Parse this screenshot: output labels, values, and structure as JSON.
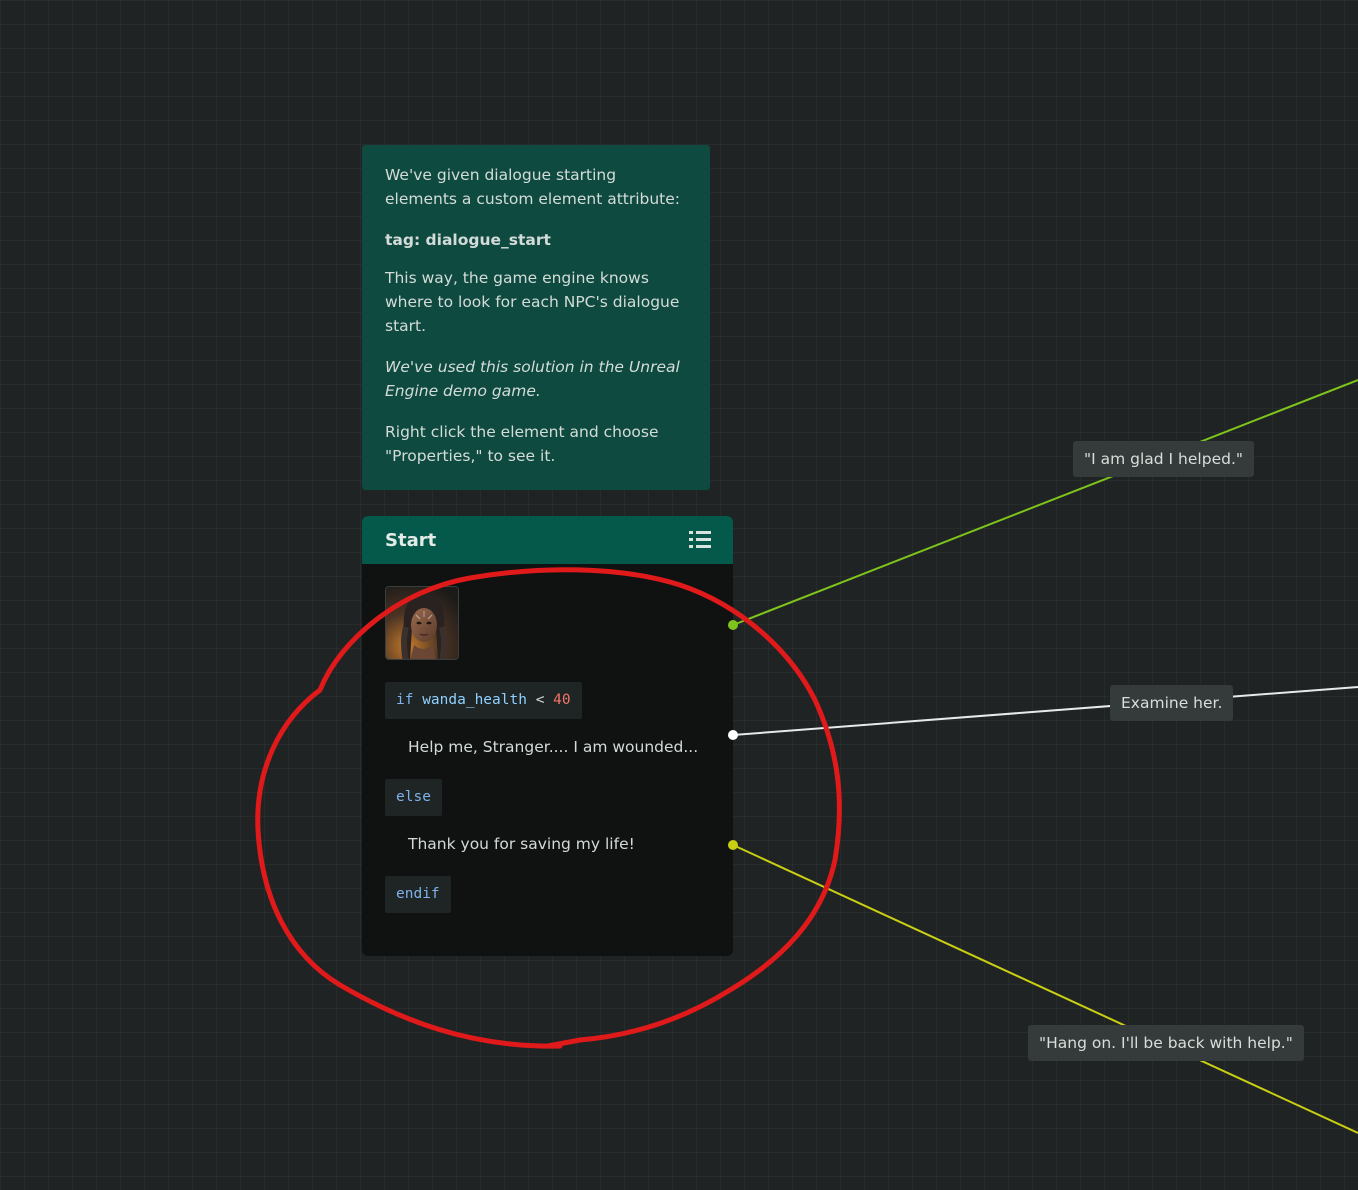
{
  "note": {
    "paragraph_1": "We've given dialogue starting elements a custom element attribute:",
    "tag_line": "tag: dialogue_start",
    "paragraph_2": "This way, the game engine knows where to look for each NPC's dialogue start.",
    "paragraph_3": "We've used this solution in the Unreal Engine demo game.",
    "paragraph_4": "Right click the element and choose \"Properties,\" to see it."
  },
  "node": {
    "title": "Start",
    "menu_icon": "list-icon",
    "avatar_icon": "npc-portrait",
    "condition": {
      "keyword": "if",
      "variable": "wanda_health",
      "operator": "<",
      "value": "40"
    },
    "line_1": "Help me, Stranger.... I am wounded...",
    "else_label": "else",
    "line_2": "Thank you for saving my life!",
    "endif_label": "endif"
  },
  "edges": {
    "glad": "\"I am glad I helped.\"",
    "examine": "Examine her.",
    "hang_on": "\"Hang on. I'll be back with help.\""
  },
  "colors": {
    "canvas": "#1f2323",
    "note_bg": "#0f4a40",
    "node_header": "#05594a",
    "node_body": "#101212",
    "pin_green": "#7ec41d",
    "pin_white": "#ffffff",
    "pin_yellow": "#c9cf12",
    "annotation_red": "#e01a1a"
  }
}
